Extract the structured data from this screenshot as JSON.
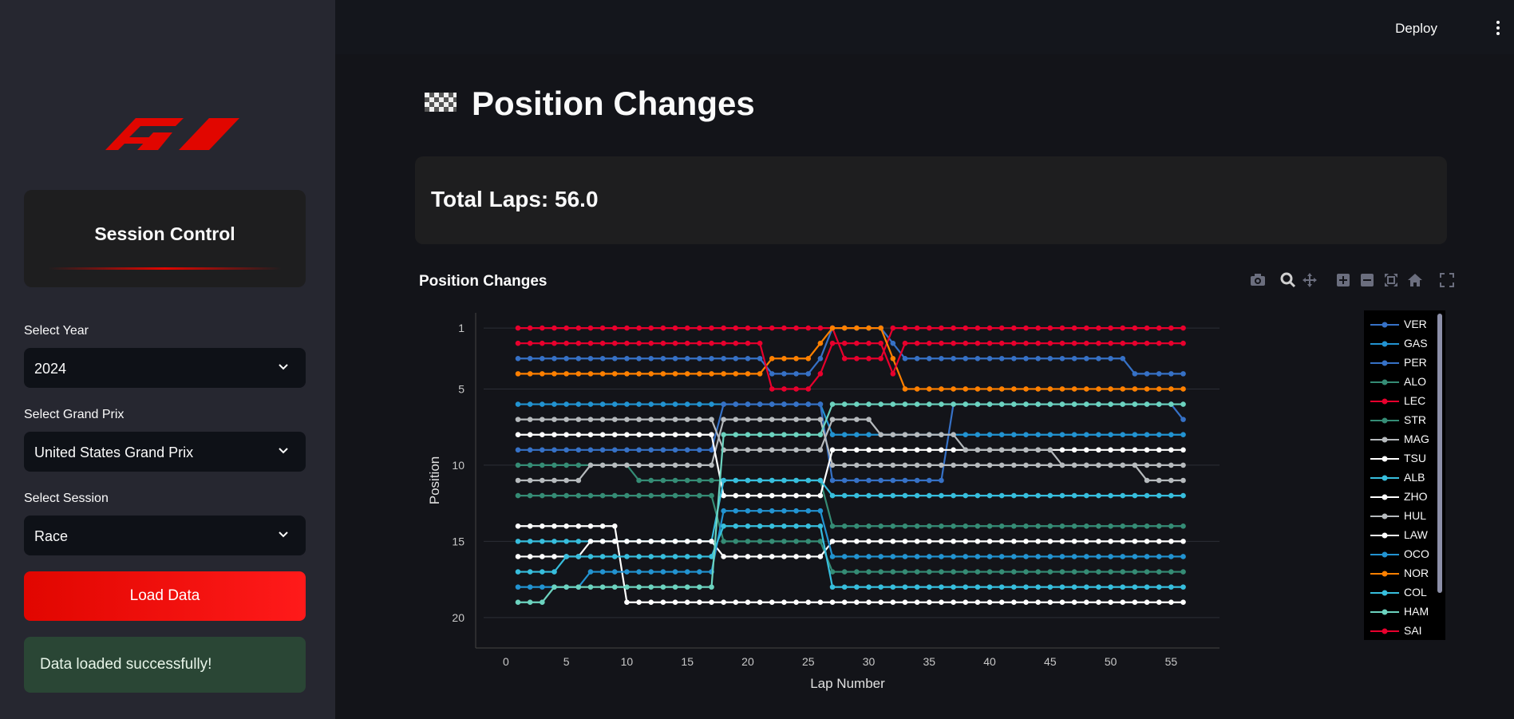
{
  "sidebar": {
    "session_title": "Session Control",
    "year_label": "Select Year",
    "year_value": "2024",
    "gp_label": "Select Grand Prix",
    "gp_value": "United States Grand Prix",
    "session_label": "Select Session",
    "session_value": "Race",
    "load_button": "Load Data",
    "success_message": "Data loaded successfully!"
  },
  "header": {
    "deploy_label": "Deploy"
  },
  "main": {
    "title": "Position Changes",
    "total_laps": "Total Laps: 56.0",
    "chart_title": "Position Changes"
  },
  "icons": {
    "logo": "f1-logo-icon",
    "title": "checkered-flag-icon",
    "modebar": [
      "camera-icon",
      "zoom-icon",
      "pan-icon",
      "zoom-in-icon",
      "zoom-out-icon",
      "autoscale-icon",
      "reset-axes-icon",
      "fullscreen-icon"
    ]
  },
  "chart_data": {
    "type": "line",
    "xlabel": "Lap Number",
    "ylabel": "Position",
    "xlim": [
      -2.5,
      59
    ],
    "ylim": [
      22,
      0
    ],
    "y_reversed": true,
    "x_ticks": [
      0,
      5,
      10,
      15,
      20,
      25,
      30,
      35,
      40,
      45,
      50,
      55
    ],
    "y_ticks": [
      1,
      5,
      10,
      15,
      20
    ],
    "grid": true,
    "legend_position": "right",
    "series": [
      {
        "name": "VER",
        "color": "#3671c6",
        "points": [
          [
            1,
            3
          ],
          [
            21,
            3
          ],
          [
            22,
            4
          ],
          [
            25,
            4
          ],
          [
            26,
            3
          ],
          [
            27,
            1
          ],
          [
            31,
            1
          ],
          [
            32,
            2
          ],
          [
            33,
            3
          ],
          [
            51,
            3
          ],
          [
            52,
            4
          ],
          [
            56,
            4
          ]
        ]
      },
      {
        "name": "GAS",
        "color": "#2293d1",
        "points": [
          [
            1,
            6
          ],
          [
            26,
            6
          ],
          [
            27,
            8
          ],
          [
            56,
            8
          ]
        ]
      },
      {
        "name": "PER",
        "color": "#3671c6",
        "points": [
          [
            1,
            9
          ],
          [
            17,
            9
          ],
          [
            18,
            6
          ],
          [
            26,
            6
          ],
          [
            27,
            11
          ],
          [
            36,
            11
          ],
          [
            37,
            6
          ],
          [
            55,
            6
          ],
          [
            56,
            7
          ]
        ]
      },
      {
        "name": "ALO",
        "color": "#358c75",
        "points": [
          [
            1,
            10
          ],
          [
            10,
            10
          ],
          [
            11,
            11
          ],
          [
            26,
            11
          ],
          [
            27,
            14
          ],
          [
            56,
            14
          ]
        ]
      },
      {
        "name": "LEC",
        "color": "#e8002d",
        "points": [
          [
            1,
            1
          ],
          [
            27,
            1
          ],
          [
            28,
            3
          ],
          [
            31,
            3
          ],
          [
            32,
            1
          ],
          [
            56,
            1
          ]
        ]
      },
      {
        "name": "STR",
        "color": "#358c75",
        "points": [
          [
            1,
            12
          ],
          [
            17,
            12
          ],
          [
            18,
            15
          ],
          [
            26,
            15
          ],
          [
            27,
            17
          ],
          [
            56,
            17
          ]
        ]
      },
      {
        "name": "MAG",
        "color": "#b6babd",
        "points": [
          [
            1,
            11
          ],
          [
            6,
            11
          ],
          [
            7,
            10
          ],
          [
            17,
            10
          ],
          [
            18,
            7
          ],
          [
            26,
            7
          ],
          [
            27,
            10
          ],
          [
            56,
            10
          ]
        ]
      },
      {
        "name": "TSU",
        "color": "#ffffff",
        "points": [
          [
            1,
            8
          ],
          [
            17,
            8
          ],
          [
            18,
            12
          ],
          [
            26,
            12
          ],
          [
            27,
            9
          ],
          [
            56,
            9
          ]
        ]
      },
      {
        "name": "ALB",
        "color": "#37bedd",
        "points": [
          [
            1,
            15
          ],
          [
            17,
            15
          ],
          [
            18,
            11
          ],
          [
            26,
            11
          ],
          [
            27,
            12
          ],
          [
            56,
            12
          ]
        ]
      },
      {
        "name": "ZHO",
        "color": "#ffffff",
        "points": [
          [
            1,
            14
          ],
          [
            9,
            14
          ],
          [
            10,
            19
          ],
          [
            56,
            19
          ]
        ]
      },
      {
        "name": "HUL",
        "color": "#b6babd",
        "points": [
          [
            1,
            7
          ],
          [
            17,
            7
          ],
          [
            18,
            9
          ],
          [
            26,
            9
          ],
          [
            27,
            7
          ],
          [
            56,
            11
          ]
        ]
      },
      {
        "name": "LAW",
        "color": "#ffffff",
        "points": [
          [
            1,
            16
          ],
          [
            6,
            16
          ],
          [
            7,
            15
          ],
          [
            17,
            15
          ],
          [
            18,
            16
          ],
          [
            26,
            16
          ],
          [
            27,
            15
          ],
          [
            56,
            15
          ]
        ]
      },
      {
        "name": "OCO",
        "color": "#2293d1",
        "points": [
          [
            1,
            18
          ],
          [
            6,
            18
          ],
          [
            7,
            17
          ],
          [
            17,
            17
          ],
          [
            18,
            13
          ],
          [
            26,
            13
          ],
          [
            27,
            16
          ],
          [
            56,
            16
          ]
        ]
      },
      {
        "name": "NOR",
        "color": "#ff8000",
        "points": [
          [
            1,
            4
          ],
          [
            21,
            4
          ],
          [
            22,
            3
          ],
          [
            25,
            3
          ],
          [
            26,
            2
          ],
          [
            27,
            1
          ],
          [
            31,
            1
          ],
          [
            32,
            3
          ],
          [
            33,
            5
          ],
          [
            56,
            5
          ]
        ]
      },
      {
        "name": "COL",
        "color": "#37bedd",
        "points": [
          [
            1,
            17
          ],
          [
            4,
            17
          ],
          [
            5,
            16
          ],
          [
            17,
            16
          ],
          [
            18,
            14
          ],
          [
            26,
            14
          ],
          [
            27,
            18
          ],
          [
            56,
            18
          ]
        ]
      },
      {
        "name": "HAM",
        "color": "#6cd3bf",
        "points": [
          [
            1,
            19
          ],
          [
            3,
            19
          ],
          [
            4,
            18
          ],
          [
            17,
            18
          ],
          [
            18,
            8
          ],
          [
            26,
            8
          ],
          [
            27,
            6
          ],
          [
            56,
            6
          ]
        ]
      },
      {
        "name": "SAI",
        "color": "#e8002d",
        "points": [
          [
            1,
            2
          ],
          [
            21,
            2
          ],
          [
            22,
            5
          ],
          [
            25,
            5
          ],
          [
            26,
            4
          ],
          [
            27,
            2
          ],
          [
            31,
            2
          ],
          [
            32,
            4
          ],
          [
            33,
            2
          ],
          [
            56,
            2
          ]
        ]
      }
    ]
  }
}
